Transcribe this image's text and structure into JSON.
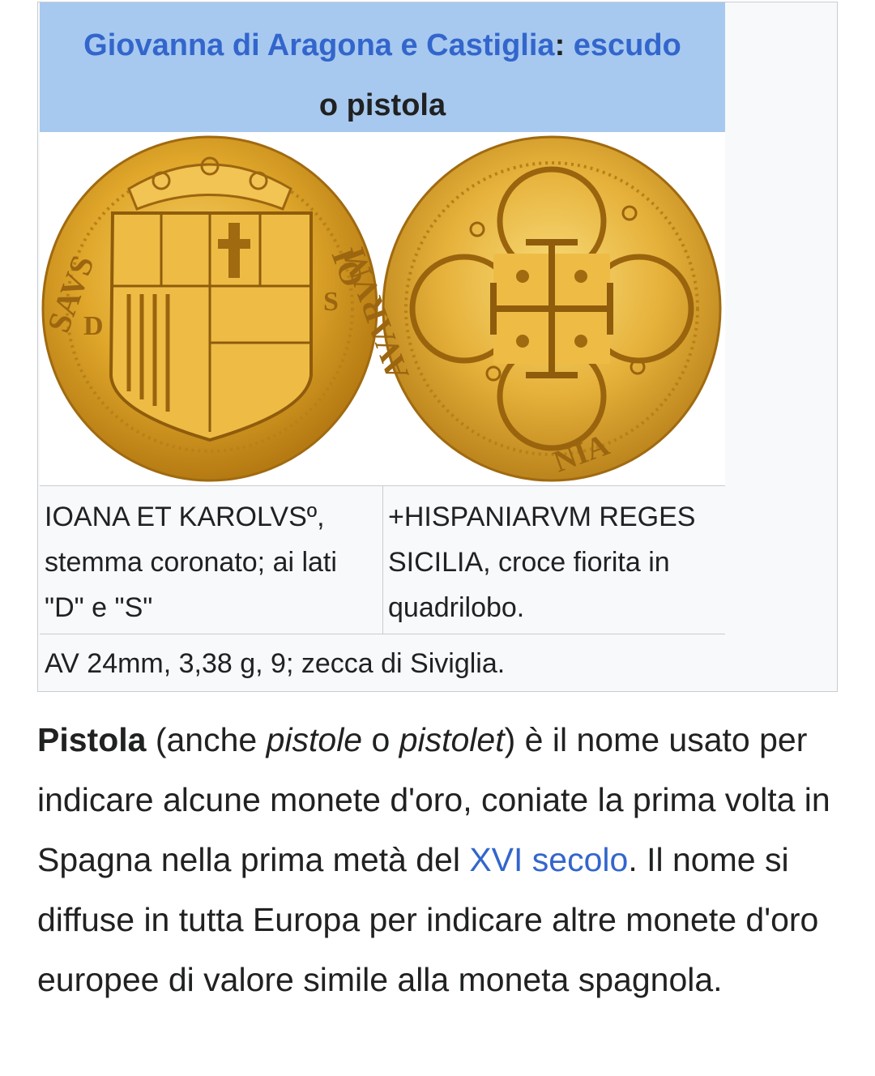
{
  "infobox": {
    "title_link_1": "Giovanna di Aragona e Castiglia",
    "title_sep": ": ",
    "title_link_2": "escudo",
    "title_rest": "o pistola",
    "obverse_desc": "IOANA ET KAROLVSº, stemma coronato; ai lati \"D\" e \"S\"",
    "reverse_desc": "+HISPANIARVM REGES SICILIA, croce fiorita in quadrilobo.",
    "caption": "AV 24mm, 3,38 g, 9; zecca di Siviglia."
  },
  "article": {
    "term": "Pistola",
    "p1": " (anche ",
    "alt1": "pistole",
    "p2": " o ",
    "alt2": "pistolet",
    "p3": ") è il nome usato per indicare alcune monete d'oro, coniate la prima volta in Spagna nella prima metà del ",
    "link_century": "XVI secolo",
    "p4": ". Il nome si diffuse in tutta Europa per indicare altre monete d'oro europee di valore simile alla moneta spagnola."
  },
  "colors": {
    "link": "#3366cc",
    "title_bg": "#a8c9ef",
    "gold": "#d9a52a"
  }
}
